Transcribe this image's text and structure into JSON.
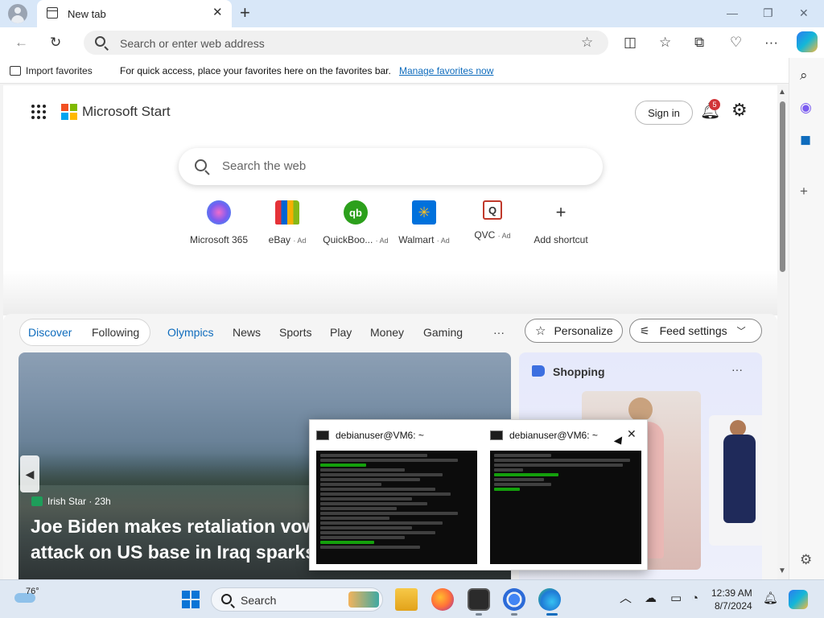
{
  "browser": {
    "tab_title": "New tab",
    "tab_close": "✕",
    "new_tab": "+",
    "address_placeholder": "Search or enter web address"
  },
  "favorites_bar": {
    "import_label": "Import favorites",
    "message": "For quick access, place your favorites here on the favorites bar.",
    "manage_link": "Manage favorites now"
  },
  "msn": {
    "brand": "Microsoft Start",
    "sign_in": "Sign in",
    "notification_count": "5",
    "search_placeholder": "Search the web",
    "shortcuts": [
      {
        "label": "Microsoft 365",
        "ad": "",
        "icon": "m365-icon",
        "color": "#7b5cf0"
      },
      {
        "label": "eBay",
        "ad": "· Ad",
        "icon": "ebay-icon",
        "color": "#e53238"
      },
      {
        "label": "QuickBoo...",
        "ad": "· Ad",
        "icon": "quickbooks-icon",
        "color": "#2ca01c"
      },
      {
        "label": "Walmart",
        "ad": "· Ad",
        "icon": "walmart-icon",
        "color": "#0071dc"
      },
      {
        "label": "QVC",
        "ad": "· Ad",
        "icon": "qvc-icon",
        "color": "#c0392b"
      },
      {
        "label": "Add shortcut",
        "ad": "",
        "icon": "plus-icon",
        "color": "#333333"
      }
    ],
    "feed_tabs": [
      "Discover",
      "Following",
      "Olympics",
      "News",
      "Sports",
      "Play",
      "Money",
      "Gaming",
      "···"
    ],
    "personalize": "Personalize",
    "feed_settings": "Feed settings",
    "hero": {
      "source": "Irish Star · 23h",
      "headline": "Joe Biden makes retaliation vow attack on US base in Iraq sparks"
    },
    "shopping": {
      "title": "Shopping",
      "more": "···"
    }
  },
  "taskbar_preview": {
    "windows": [
      {
        "title": "debianuser@VM6: ~"
      },
      {
        "title": "debianuser@VM6: ~"
      }
    ],
    "close": "✕"
  },
  "taskbar": {
    "weather_temp": "76°",
    "search_label": "Search",
    "time": "12:39 AM",
    "date": "8/7/2024"
  },
  "colors": {
    "accent": "#0f6cbd",
    "ms_red": "#f25022",
    "ms_green": "#7fba00",
    "ms_blue": "#00a4ef",
    "ms_yellow": "#ffb900"
  }
}
